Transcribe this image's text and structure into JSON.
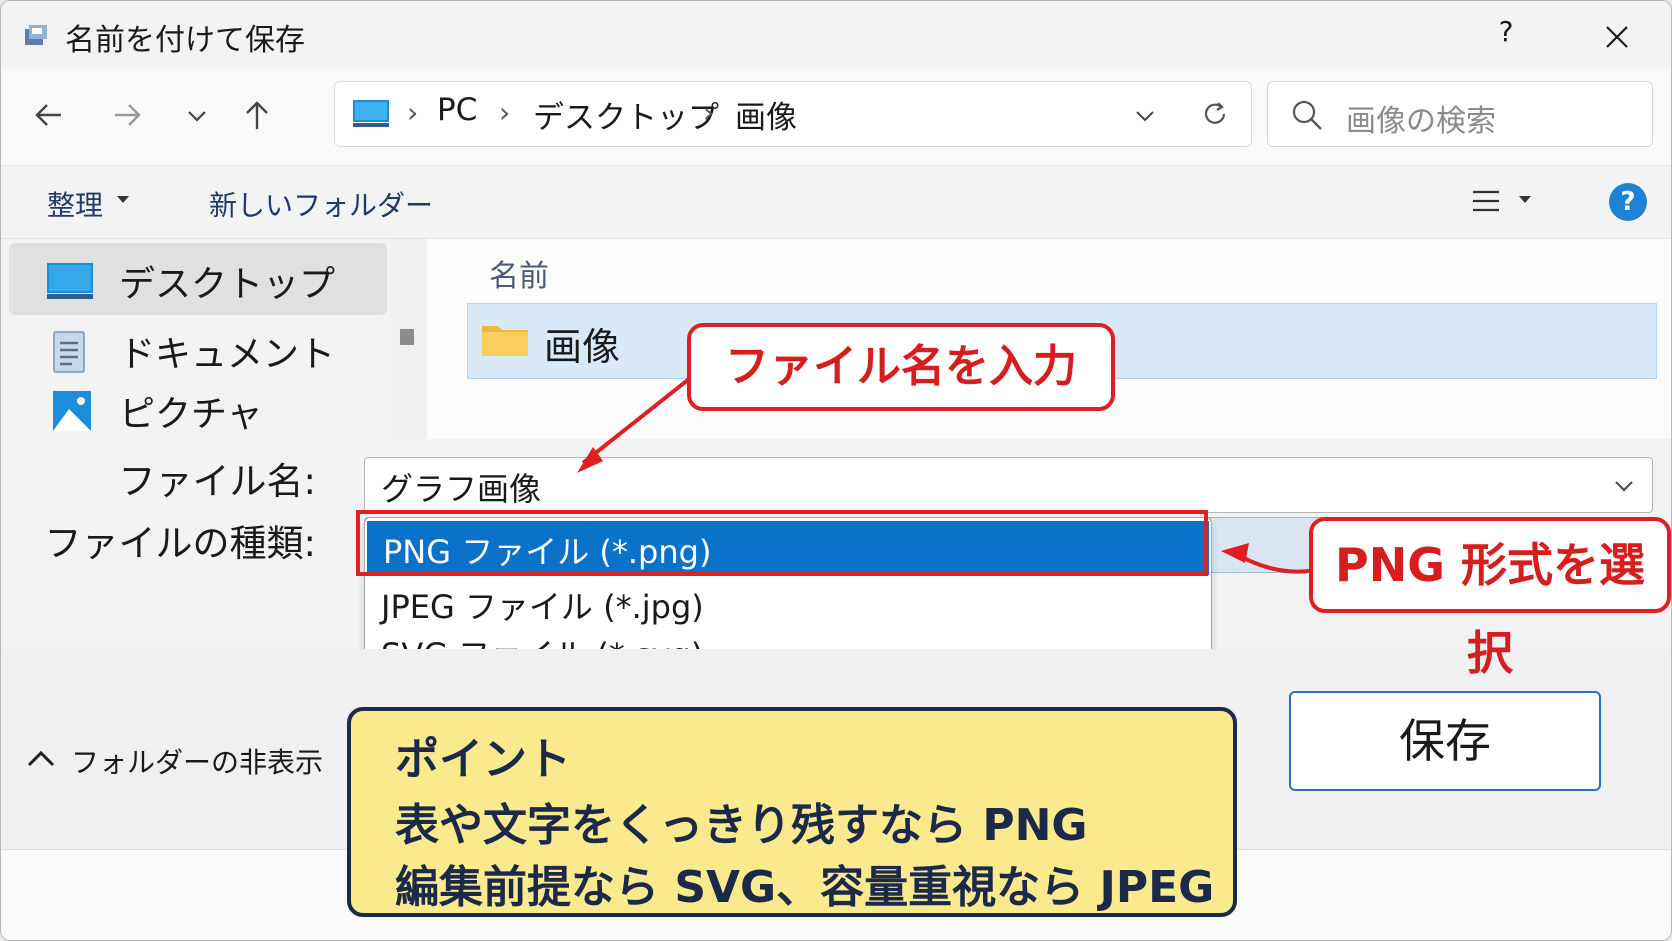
{
  "window": {
    "title": "名前を付けて保存",
    "help_label": "?",
    "icons": {
      "app": "save-dialog-icon",
      "close": "close-icon"
    }
  },
  "address_bar": {
    "breadcrumbs": [
      "PC",
      "デスクトップ",
      "画像"
    ],
    "search_placeholder": "画像の検索"
  },
  "toolbar": {
    "organize_label": "整理",
    "new_folder_label": "新しいフォルダー",
    "help_label": "?"
  },
  "nav_pane": {
    "items": [
      {
        "label": "デスクトップ",
        "icon": "desktop-icon",
        "selected": true
      },
      {
        "label": "ドキュメント",
        "icon": "document-icon",
        "selected": false
      },
      {
        "label": "ピクチャ",
        "icon": "pictures-icon",
        "selected": false
      }
    ]
  },
  "file_list": {
    "column_name": "名前",
    "rows": [
      {
        "name": "画像",
        "type": "folder",
        "selected": true
      }
    ]
  },
  "form": {
    "filename_label": "ファイル名:",
    "filename_value": "グラフ画像",
    "filetype_label": "ファイルの種類:",
    "filetype_options": [
      {
        "label": "PNG ファイル (*.png)",
        "selected": true
      },
      {
        "label": "JPEG ファイル (*.jpg)",
        "selected": false
      },
      {
        "label": "SVG ファイル (*.svg)",
        "selected": false
      }
    ]
  },
  "bottom": {
    "hide_folders_label": "フォルダーの非表示",
    "save_label": "保存"
  },
  "annotations": {
    "callout_filename": "ファイル名を入力",
    "callout_png": "PNG 形式を選択",
    "point": {
      "heading": "ポイント",
      "line1": "表や文字をくっきり残すなら PNG",
      "line2": "編集前提なら SVG、容量重視なら JPEG"
    }
  },
  "colors": {
    "accent": "#0a72c8",
    "annotation_red": "#e02020",
    "point_bg": "#fbe98e",
    "point_border": "#1c2a4a",
    "selection_row": "#d9e9f7"
  }
}
